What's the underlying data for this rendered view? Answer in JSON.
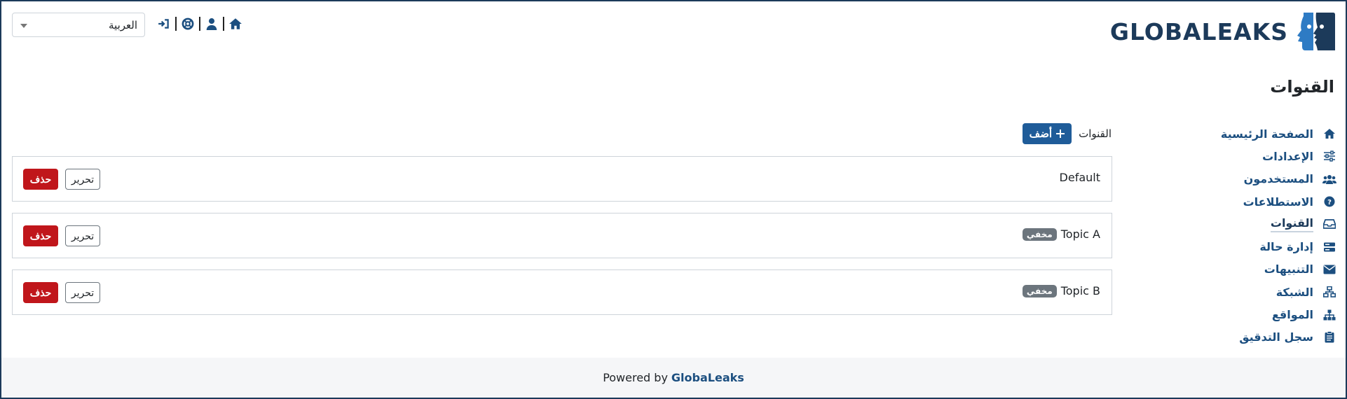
{
  "header": {
    "language_select": {
      "value": "العربية"
    },
    "logo": {
      "word": "GLOBALEAKS"
    },
    "icons": [
      "home-icon",
      "user-icon",
      "support-icon",
      "logout-icon"
    ]
  },
  "page_title": "القنوات",
  "sidebar": {
    "items": [
      {
        "label": "الصفحة الرئيسية",
        "icon": "home-icon",
        "active": false
      },
      {
        "label": "الإعدادات",
        "icon": "sliders-icon",
        "active": false
      },
      {
        "label": "المستخدمون",
        "icon": "users-icon",
        "active": false
      },
      {
        "label": "الاستطلاعات",
        "icon": "question-icon",
        "active": false
      },
      {
        "label": "القنوات",
        "icon": "inbox-icon",
        "active": true
      },
      {
        "label": "إدارة حالة",
        "icon": "server-icon",
        "active": false
      },
      {
        "label": "التنبيهات",
        "icon": "envelope-icon",
        "active": false
      },
      {
        "label": "الشبكة",
        "icon": "network-icon",
        "active": false
      },
      {
        "label": "المواقع",
        "icon": "sitemap-icon",
        "active": false
      },
      {
        "label": "سجل التدقيق",
        "icon": "clipboard-icon",
        "active": false
      }
    ]
  },
  "main": {
    "section_label": "القنوات",
    "add_button": "أضف",
    "channels": [
      {
        "name": "Default",
        "badge": "",
        "edit": "تحرير",
        "delete": "حذف"
      },
      {
        "name": "Topic A",
        "badge": "مخفي",
        "edit": "تحرير",
        "delete": "حذف"
      },
      {
        "name": "Topic B",
        "badge": "مخفي",
        "edit": "تحرير",
        "delete": "حذف"
      }
    ]
  },
  "footer": {
    "prefix": "Powered by",
    "brand": "GlobaLeaks"
  },
  "colors": {
    "brand": "#1c3a5a",
    "link": "#1c4f80",
    "primary": "#1f5c99",
    "danger": "#c0161b",
    "badge": "#6c757d"
  }
}
